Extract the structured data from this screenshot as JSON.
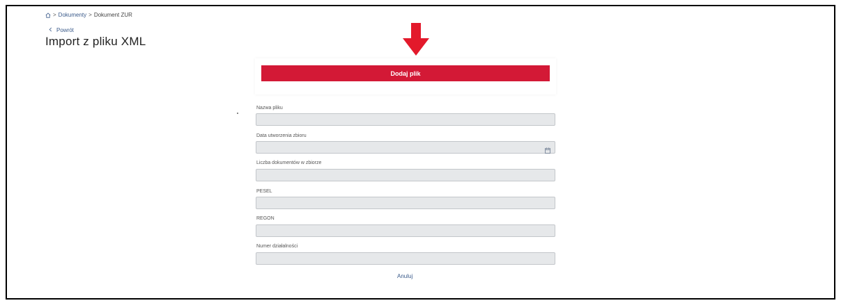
{
  "breadcrumb": {
    "home_icon": "home-icon",
    "separator": ">",
    "items": [
      "Dokumenty",
      "Dokument ZUR"
    ]
  },
  "back": {
    "label": "Powrót",
    "icon": "chevron-left-icon"
  },
  "page": {
    "title": "Import z pliku XML"
  },
  "annotation": {
    "icon": "arrow-down-icon",
    "color": "#e3192b"
  },
  "upload": {
    "button_label": "Dodaj plik",
    "button_color": "#d31936"
  },
  "form": {
    "fields": [
      {
        "label": "Nazwa pliku",
        "value": ""
      },
      {
        "label": "Data utworzenia zbioru",
        "value": "",
        "icon": "calendar-icon"
      },
      {
        "label": "Liczba dokumentów w zbiorze",
        "value": ""
      },
      {
        "label": "PESEL",
        "value": ""
      },
      {
        "label": "REGON",
        "value": ""
      },
      {
        "label": "Numer działalności",
        "value": ""
      }
    ]
  },
  "actions": {
    "cancel_label": "Anuluj"
  }
}
